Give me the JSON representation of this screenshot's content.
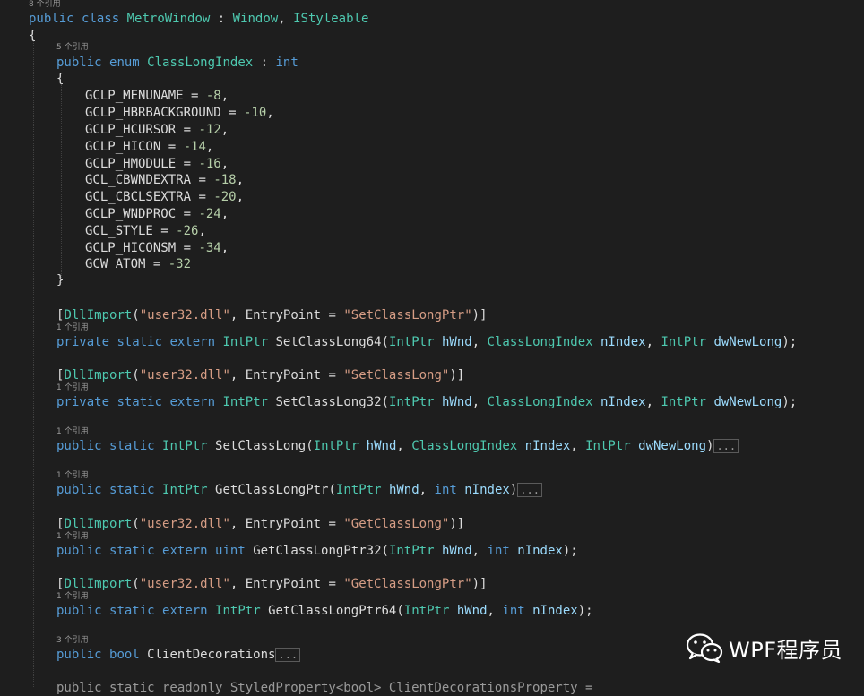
{
  "ref_labels": {
    "r8": "8 个引用",
    "r5": "5 个引用",
    "r1": "1 个引用",
    "r3": "3 个引用"
  },
  "tokens": {
    "public": "public",
    "private": "private",
    "static": "static",
    "extern": "extern",
    "class": "class",
    "enum": "enum",
    "int": "int",
    "uint": "uint",
    "bool": "bool",
    "IntPtr": "IntPtr",
    "hWnd": "hWnd",
    "nIndex": "nIndex",
    "dwNewLong": "dwNewLong",
    "ClassLongIndex": "ClassLongIndex",
    "DllImport": "DllImport",
    "EntryPoint": "EntryPoint",
    "user32": "\"user32.dll\"",
    "fold": "..."
  },
  "class_decl": {
    "name": "MetroWindow",
    "base1": "Window",
    "base2": "IStyleable"
  },
  "enum_decl": {
    "name": "ClassLongIndex",
    "members": [
      {
        "name": "GCLP_MENUNAME",
        "value": "-8"
      },
      {
        "name": "GCLP_HBRBACKGROUND",
        "value": "-10"
      },
      {
        "name": "GCLP_HCURSOR",
        "value": "-12"
      },
      {
        "name": "GCLP_HICON",
        "value": "-14"
      },
      {
        "name": "GCLP_HMODULE",
        "value": "-16"
      },
      {
        "name": "GCL_CBWNDEXTRA",
        "value": "-18"
      },
      {
        "name": "GCL_CBCLSEXTRA",
        "value": "-20"
      },
      {
        "name": "GCLP_WNDPROC",
        "value": "-24"
      },
      {
        "name": "GCL_STYLE",
        "value": "-26"
      },
      {
        "name": "GCLP_HICONSM",
        "value": "-34"
      },
      {
        "name": "GCW_ATOM",
        "value": "-32"
      }
    ]
  },
  "methods": {
    "set64_entry": "\"SetClassLongPtr\"",
    "set64_name": "SetClassLong64",
    "set32_entry": "\"SetClassLong\"",
    "set32_name": "SetClassLong32",
    "set_name": "SetClassLong",
    "get_name": "GetClassLongPtr",
    "get32_entry": "\"GetClassLong\"",
    "get32_name": "GetClassLongPtr32",
    "get64_entry": "\"GetClassLongPtr\"",
    "get64_name": "GetClassLongPtr64",
    "prop_name": "ClientDecorations"
  },
  "partial_line": {
    "text": "public static readonly StyledProperty<bool> ClientDecorationsProperty ="
  },
  "watermark": {
    "text": "WPF程序员",
    "icon": "wechat-icon"
  }
}
